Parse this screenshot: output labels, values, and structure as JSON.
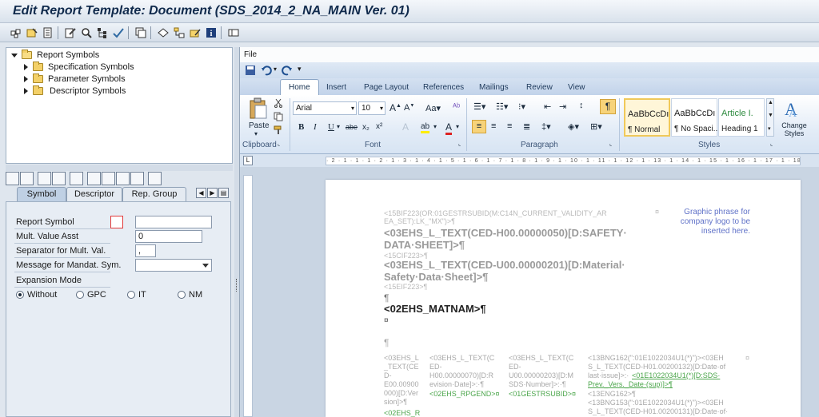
{
  "window": {
    "title": "Edit Report Template: Document (SDS_2014_2_NA_MAIN Ver. 01)"
  },
  "tree": {
    "root": "Report Symbols",
    "children": [
      "Specification Symbols",
      "Parameter Symbols",
      "Descriptor Symbols"
    ]
  },
  "tabs": [
    "Symbol",
    "Descriptor",
    "Rep. Group"
  ],
  "form": {
    "report_symbol_label": "Report Symbol",
    "report_symbol_value": "",
    "mult_value_asst_label": "Mult. Value Asst",
    "mult_value_asst_value": "0",
    "separator_label": "Separator for Mult. Val.",
    "separator_value": ",",
    "message_label": "Message for Mandat. Sym.",
    "message_value": "",
    "expansion_mode_label": "Expansion Mode",
    "expansion_options": [
      "Without",
      "GPC",
      "IT",
      "NM"
    ],
    "expansion_selected": "Without"
  },
  "word": {
    "file_menu": "File",
    "ribbon_tabs": [
      "Home",
      "Insert",
      "Page Layout",
      "References",
      "Mailings",
      "Review",
      "View"
    ],
    "active_tab": "Home",
    "clipboard": {
      "paste": "Paste",
      "label": "Clipboard"
    },
    "font": {
      "name": "Arial",
      "size": "10",
      "label": "Font"
    },
    "paragraph_label": "Paragraph",
    "styles": {
      "label": "Styles",
      "items": [
        {
          "preview": "AaBbCcDı",
          "name": "¶ Normal"
        },
        {
          "preview": "AaBbCcDı",
          "name": "¶ No Spaci..."
        },
        {
          "preview": "Article I.",
          "name": "Heading 1"
        }
      ],
      "change_styles": "Change Styles"
    },
    "ruler_text": "· 2 · 1 · 1 · 1 · 2 · 1 · 3 · 1 · 4 · 1 · 5 · 1 · 6 · 1 · 7 · 1 · 8 · 1 · 9 · 1 · 10 · 1 · 11 · 1 · 12 · 1 · 13 · 1 · 14 · 1 · 15 · 1 · 16 · 1 · 17 · 1 · 18 ·"
  },
  "document": {
    "line1": "<15BIF223(OR:01GESTRSUBID(M:C14N_CURRENT_VALIDITY_AR",
    "line2": "EA_SET):LK_\"MX\")>¶",
    "line3": "<03EHS_L_TEXT(CED-H00.00000050)[D:SAFETY·",
    "line4": "DATA·SHEET]>¶",
    "line5": "<15CIF223>¶",
    "line6": "<03EHS_L_TEXT(CED-U00.00000201)[D:Material·",
    "line7": "Safety·Data·Sheet]>¶",
    "line8": "<15EIF223>¶",
    "pilcrow1": "¶",
    "matnam": "<02EHS_MATNAM>¶",
    "cellmark": "¤",
    "pilcrow2": "¶",
    "graphic_phrase": "Graphic phrase for company logo to be inserted here.",
    "col1": "<03EHS_L\n_TEXT(CE\nD-\nE00.00900\n000)[D:Ver\nsion]>¶",
    "col1b": "<02EHS_R",
    "col2": "<03EHS_L_TEXT(C\nED-\nH00.00000070)[D:R\nevision·Date]>:·¶",
    "col2g": "<02EHS_RPGEND>¤",
    "col3": "<03EHS_L_TEXT(C\nED-\nU00.00000203)[D:M\nSDS·Number]>:·¶",
    "col3g": "<01GESTRSUBID>¤",
    "col4a": "<13BNG162(\":01E1022034U1(*)\")><03EH",
    "col4b": "S_L_TEXT(CED-H01.00200132)[D:Date·of",
    "col4c": "last·issue]>:·",
    "col4d": "<01E1022034U1(*)[D:SDS·",
    "col4e": "Prev._Vers._Date·(sup)]>¶",
    "col4f": "<13ENG162>¶",
    "col4g": "<13BNG153(\":01E1022034U1(*)\")><03EH",
    "col4h": "S_L_TEXT(CED-H01.00200131)[D:Date·of·"
  }
}
